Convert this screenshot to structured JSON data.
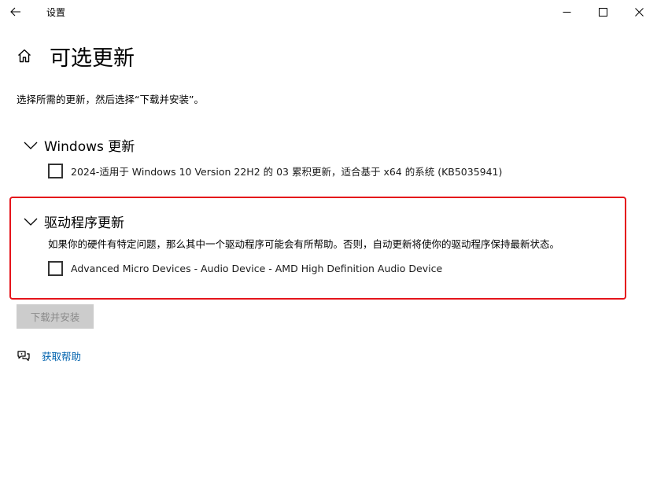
{
  "window": {
    "title": "设置",
    "back_icon": "back-arrow-icon",
    "minimize_icon": "minimize-icon",
    "maximize_icon": "maximize-icon",
    "close_icon": "close-icon"
  },
  "header": {
    "home_icon": "home-icon",
    "title": "可选更新"
  },
  "instructions": "选择所需的更新，然后选择“下载并安装”。",
  "sections": [
    {
      "title": "Windows 更新",
      "expanded": true,
      "items": [
        {
          "label": "2024-适用于 Windows 10 Version 22H2 的 03 累积更新，适合基于 x64 的系统 (KB5035941)",
          "checked": false
        }
      ]
    },
    {
      "title": "驱动程序更新",
      "expanded": true,
      "description": "如果你的硬件有特定问题，那么其中一个驱动程序可能会有所帮助。否则，自动更新将使你的驱动程序保持最新状态。",
      "items": [
        {
          "label": "Advanced Micro Devices - Audio Device - AMD High Definition Audio Device",
          "checked": false
        }
      ]
    }
  ],
  "actions": {
    "download_label": "下载并安装",
    "download_enabled": false
  },
  "help": {
    "icon": "help-chat-icon",
    "label": "获取帮助"
  },
  "colors": {
    "highlight": "#e5141b",
    "link": "#0062ad",
    "disabled_button_bg": "#cccccc",
    "disabled_button_text": "#8a8a8a"
  }
}
